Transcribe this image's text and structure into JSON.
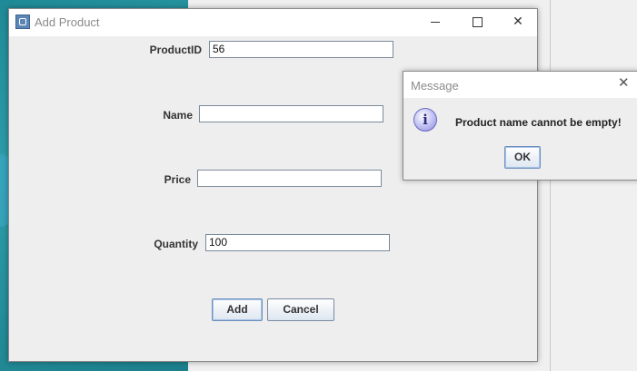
{
  "main_window": {
    "title": "Add Product",
    "form": {
      "product_id": {
        "label": "ProductID",
        "value": "56"
      },
      "name": {
        "label": "Name",
        "value": ""
      },
      "price": {
        "label": "Price",
        "value": ""
      },
      "quantity": {
        "label": "Quantity",
        "value": "100"
      }
    },
    "buttons": {
      "add": "Add",
      "cancel": "Cancel"
    }
  },
  "message_dialog": {
    "title": "Message",
    "icon": "info-icon",
    "icon_glyph": "i",
    "text": "Product name cannot be empty!",
    "ok": "OK"
  }
}
